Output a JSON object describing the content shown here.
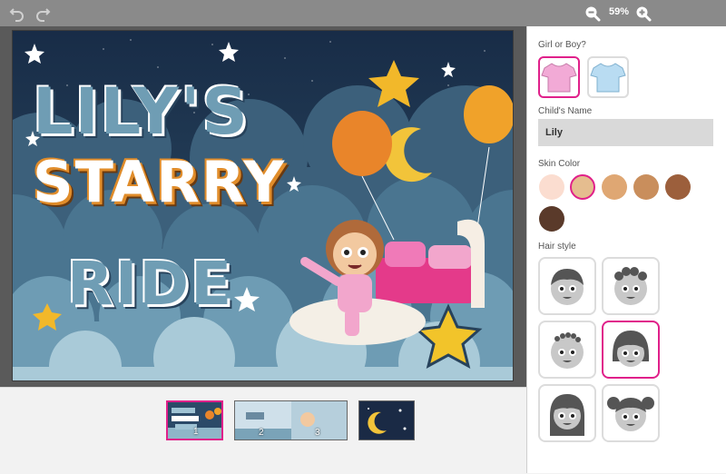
{
  "toolbar": {
    "undo_icon": "undo-icon",
    "redo_icon": "redo-icon",
    "zoom_out_icon": "zoom-out-icon",
    "zoom_in_icon": "zoom-in-icon",
    "zoom_level": "59%"
  },
  "cover": {
    "title_line1": "LILY'S",
    "title_line2": "STARRY",
    "title_line3": "RIDE"
  },
  "thumbnails": [
    {
      "number": "1",
      "selected": true
    },
    {
      "number": "2",
      "selected": false
    },
    {
      "number": "3",
      "selected": false
    },
    {
      "number": "",
      "selected": false
    }
  ],
  "panel": {
    "gender_label": "Girl or Boy?",
    "gender_options": [
      {
        "name": "girl",
        "color": "#f2aad6",
        "selected": true
      },
      {
        "name": "boy",
        "color": "#b9dcf2",
        "selected": false
      }
    ],
    "name_label": "Child's Name",
    "name_value": "Lily",
    "skin_label": "Skin Color",
    "skin_colors": [
      "#fbddd0",
      "#e5bd8f",
      "#dfa773",
      "#c98e5c",
      "#9c5f3c",
      "#5a3a2a"
    ],
    "skin_selected_index": 1,
    "hair_label": "Hair style",
    "hair_selected_index": 3
  },
  "colors": {
    "accent": "#e0208a",
    "topbar": "#8a8a8a",
    "canvas_bg": "#5a5a5a"
  }
}
